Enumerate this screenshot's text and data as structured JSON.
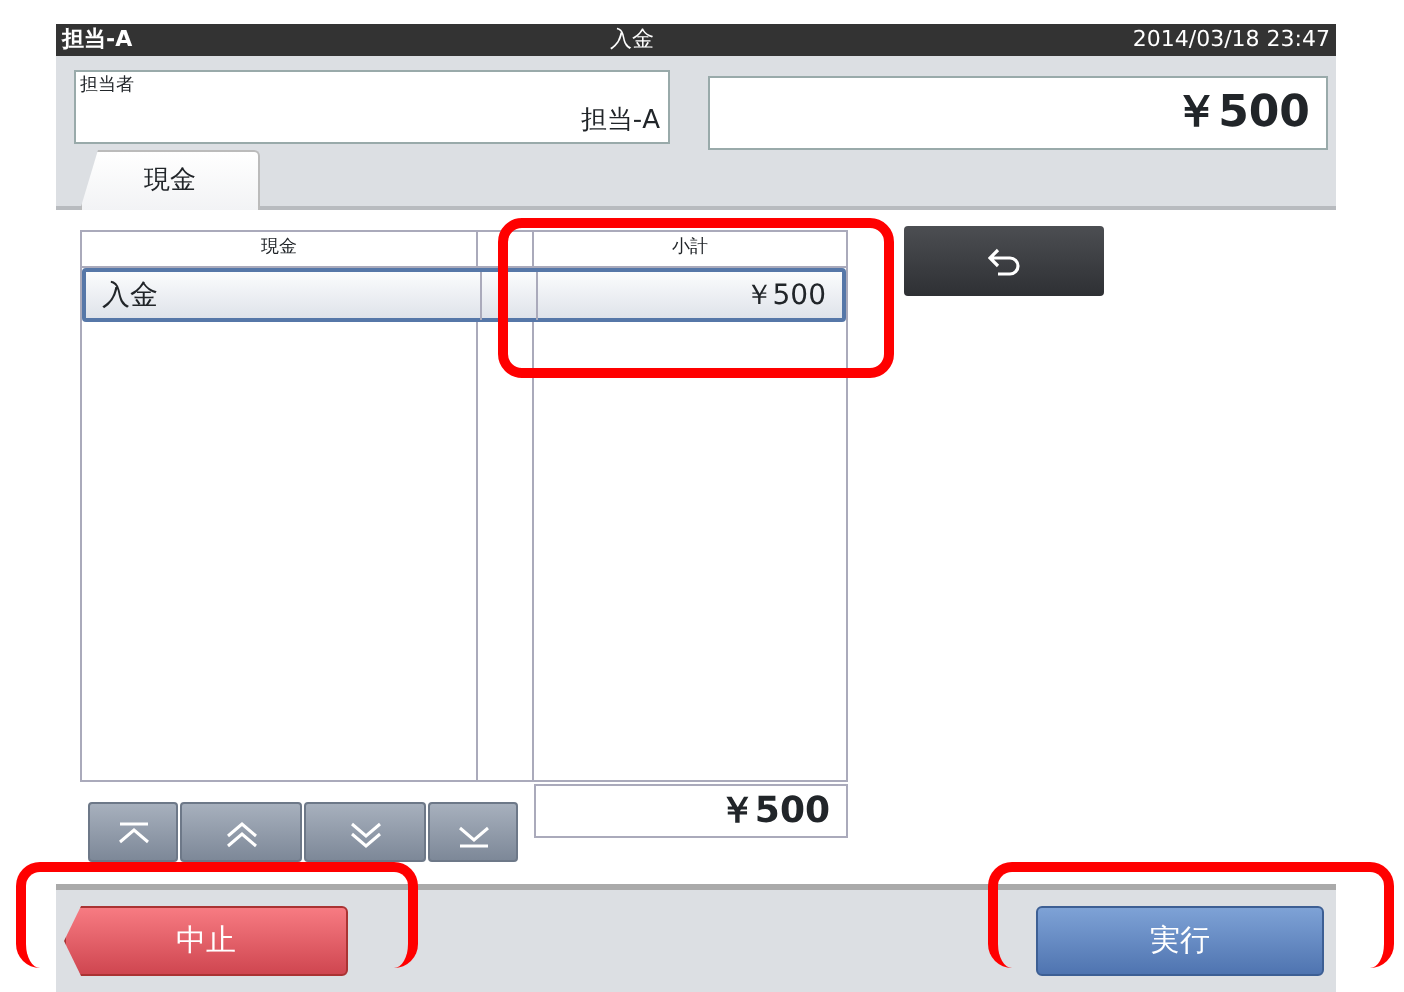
{
  "status_bar": {
    "operator": "担当-A",
    "title": "入金",
    "datetime": "2014/03/18 23:47"
  },
  "operator_field": {
    "label": "担当者",
    "value": "担当-A"
  },
  "amount_display": "￥500",
  "tabs": [
    {
      "label": "現金",
      "selected": true
    }
  ],
  "table": {
    "columns": [
      {
        "label": "現金",
        "highlighted": false
      },
      {
        "label": "小計",
        "highlighted": true
      }
    ],
    "rows": [
      {
        "cells": [
          "入金",
          "￥500"
        ],
        "selected": true
      }
    ]
  },
  "total": "￥500",
  "footer_buttons": [
    {
      "kind": "cancel",
      "label": "中止",
      "highlighted": true
    },
    {
      "kind": "execute",
      "label": "実行",
      "highlighted": true
    }
  ]
}
